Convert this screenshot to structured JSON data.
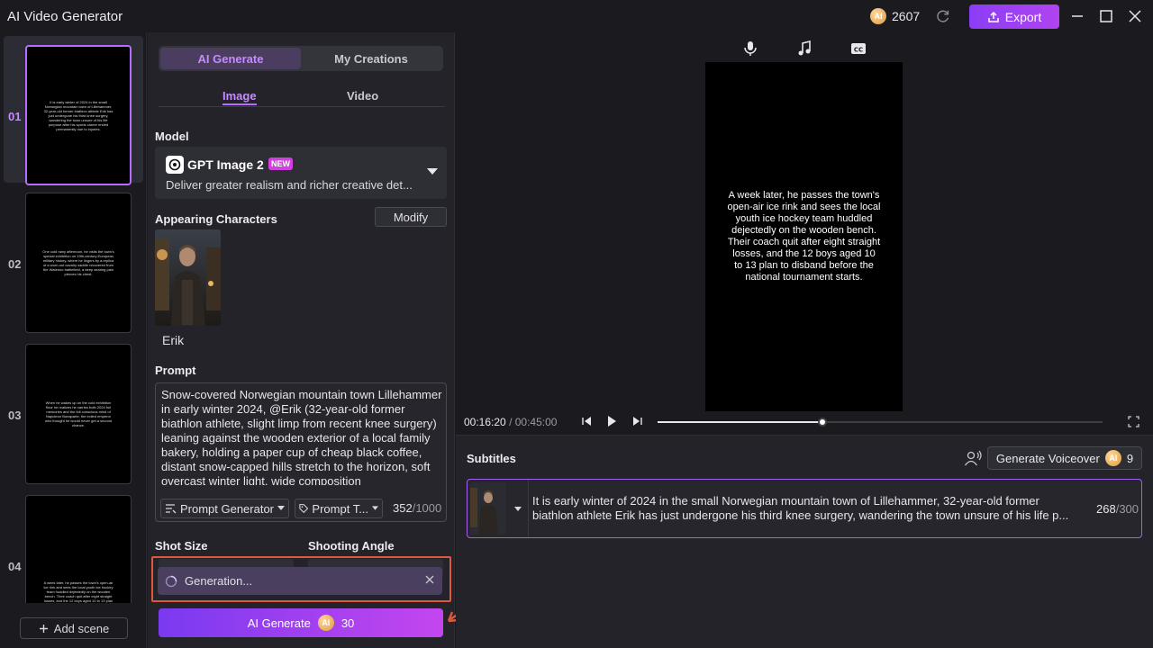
{
  "app": {
    "title": "AI Video Generator",
    "credits": "2607",
    "export_label": "Export"
  },
  "colors": {
    "accent": "#b86cff",
    "brand_gradient_start": "#7a3af0",
    "brand_gradient_end": "#c446ef",
    "highlight_outline": "#e0573e"
  },
  "scenes": [
    {
      "num": "01",
      "text": "It is early winter of 2024 in the small Norwegian mountain town of Lillehammer, 32-year-old former biathlon athlete Erik has just undergone his third knee surgery, wandering the town unsure of his life purpose after his sports career ended permanently due to injuries."
    },
    {
      "num": "02",
      "text": "One cold rainy afternoon, he visits the town's special exhibition on 19th-century European military history, where he lingers by a replica of a worn-out cavalry saddle recovered from the Waterloo battlefield, a deep searing pain pierces his chest."
    },
    {
      "num": "03",
      "text": "When he wakes up on the cold exhibition floor he realizes he carries both 2024 full memories and the full conscious mind of Napoleon Bonaparte, the exiled emperor who thought he would never get a second chance."
    },
    {
      "num": "04",
      "text": "A week later, he passes the town's open-air ice rink and sees the local youth ice hockey team huddled dejectedly on the wooden bench. Their coach quit after eight straight losses, and the 12 boys aged 10 to 13 plan to disband."
    }
  ],
  "add_scene_label": "Add scene",
  "panel": {
    "tab_ai_generate": "AI Generate",
    "tab_my_creations": "My Creations",
    "subtab_image": "Image",
    "subtab_video": "Video",
    "model_label": "Model",
    "model_name": "GPT Image 2",
    "model_badge": "NEW",
    "model_desc": "Deliver greater realism and richer creative det...",
    "characters_label": "Appearing Characters",
    "modify_label": "Modify",
    "character_name": "Erik",
    "prompt_label": "Prompt",
    "prompt_text": "Snow-covered Norwegian mountain town Lillehammer in early winter 2024, @Erik (32-year-old former biathlon athlete, slight limp from recent knee surgery) leaning against the wooden exterior of a local family bakery, holding a paper cup of cheap black coffee, distant snow-capped hills stretch to the horizon, soft overcast winter light, wide composition",
    "prompt_generator_label": "Prompt Generator",
    "prompt_template_label": "Prompt T...",
    "char_count": "352",
    "char_max": "/1000",
    "shot_size_label": "Shot Size",
    "shooting_angle_label": "Shooting Angle",
    "generation_status": "Generation...",
    "generate_label": "AI Generate",
    "generate_cost": "30"
  },
  "player": {
    "caption": "A week later, he passes the town's open-air ice rink and sees the local youth ice hockey team huddled dejectedly on the wooden bench. Their coach quit after eight straight losses, and the 12 boys aged 10 to 13 plan to disband before the national tournament starts.",
    "current_time": "00:16:20",
    "total_time": "/ 00:45:00",
    "progress": 0.37
  },
  "subtitles": {
    "title": "Subtitles",
    "generate_voiceover_label": "Generate Voiceover",
    "voiceover_cost": "9",
    "row_line1": "It is early winter of 2024 in the small Norwegian mountain town of Lillehammer, 32-year-old former",
    "row_line2": "biathlon athlete Erik has just undergone his third knee surgery, wandering the town unsure of his life p...",
    "row_count": "268",
    "row_max": "/300"
  }
}
